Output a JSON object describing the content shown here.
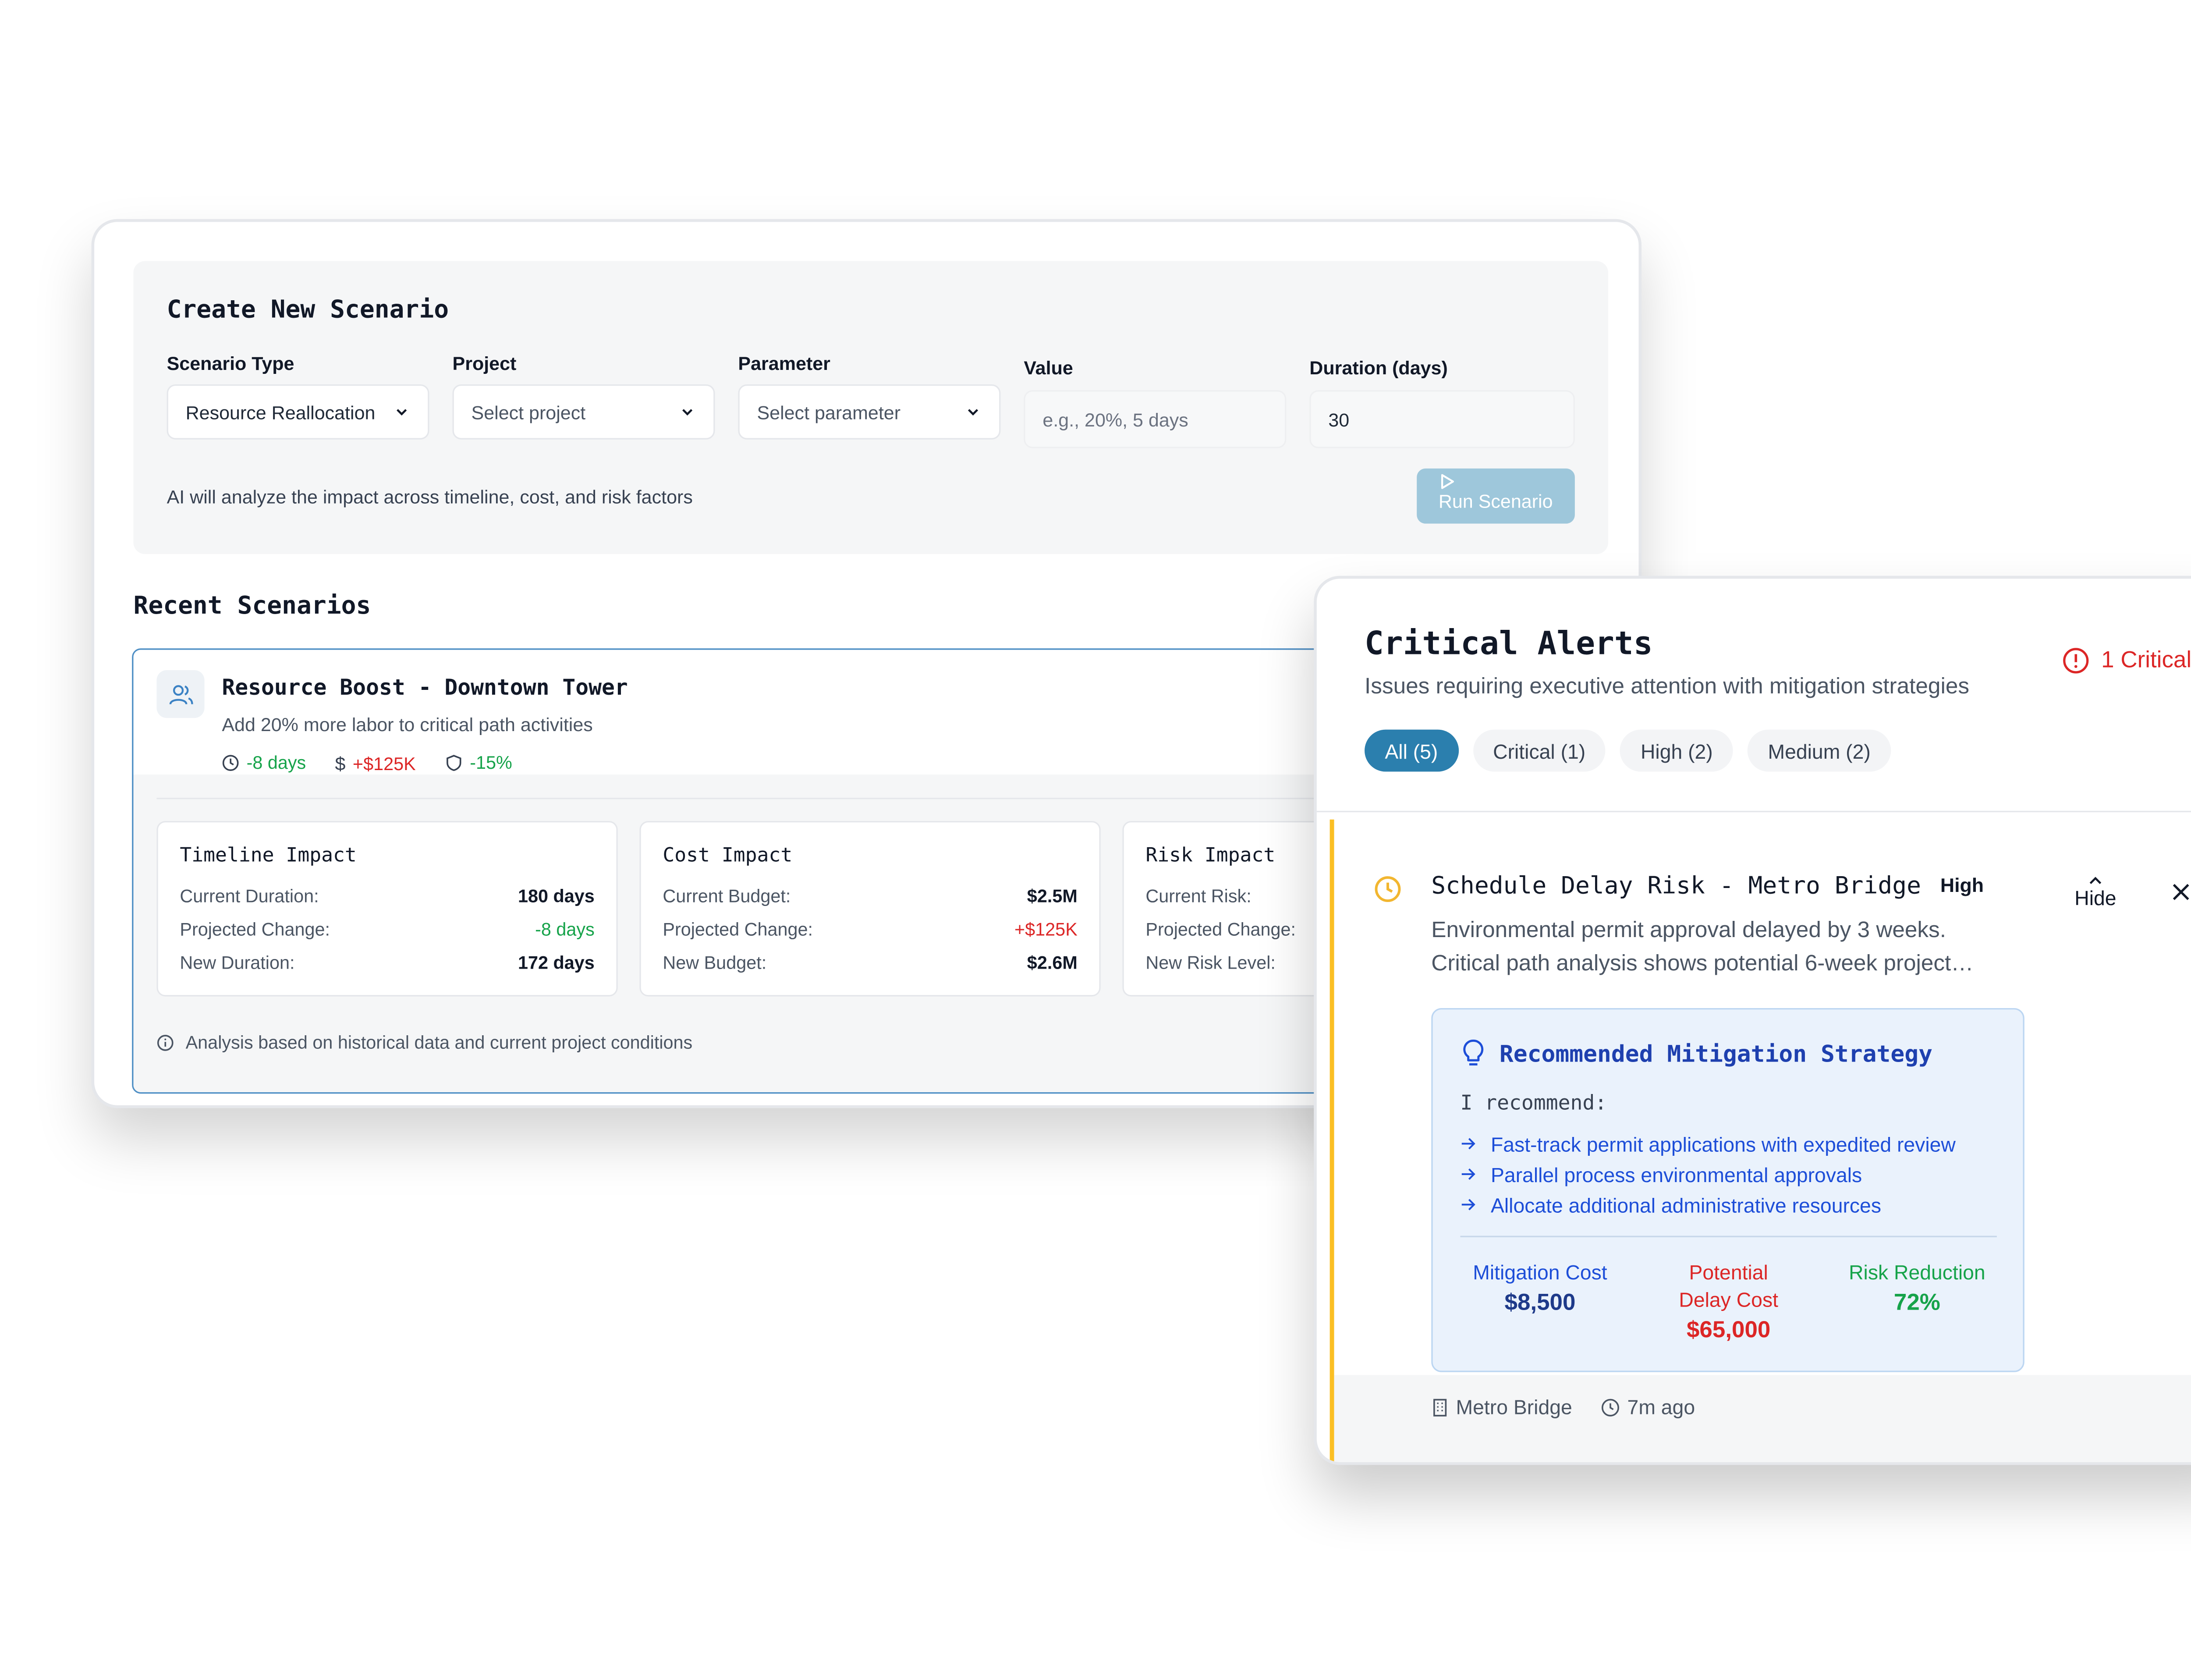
{
  "scenario_form": {
    "title": "Create New Scenario",
    "fields": {
      "type_label": "Scenario Type",
      "type_value": "Resource Reallocation",
      "project_label": "Project",
      "project_placeholder": "Select project",
      "parameter_label": "Parameter",
      "parameter_placeholder": "Select parameter",
      "value_label": "Value",
      "value_placeholder": "e.g., 20%, 5 days",
      "duration_label": "Duration (days)",
      "duration_value": "30"
    },
    "note": "AI will analyze the impact across timeline, cost, and risk factors",
    "run_button": "Run Scenario"
  },
  "recent": {
    "title": "Recent Scenarios",
    "scenario": {
      "name": "Resource Boost - Downtown Tower",
      "description": "Add 20% more labor to critical path activities",
      "metrics": {
        "time": "-8 days",
        "cost": "+$125K",
        "risk": "-15%"
      },
      "impacts": [
        {
          "title": "Timeline Impact",
          "rows": [
            {
              "label": "Current Duration:",
              "value": "180 days"
            },
            {
              "label": "Projected Change:",
              "value": "-8 days"
            },
            {
              "label": "New Duration:",
              "value": "172 days"
            }
          ]
        },
        {
          "title": "Cost Impact",
          "rows": [
            {
              "label": "Current Budget:",
              "value": "$2.5M"
            },
            {
              "label": "Projected Change:",
              "value": "+$125K"
            },
            {
              "label": "New Budget:",
              "value": "$2.6M"
            }
          ]
        },
        {
          "title": "Risk Impact",
          "rows": [
            {
              "label": "Current Risk:",
              "value": ""
            },
            {
              "label": "Projected Change:",
              "value": ""
            },
            {
              "label": "New Risk Level:",
              "value": ""
            }
          ]
        }
      ],
      "footnote": "Analysis based on historical data and current project conditions"
    }
  },
  "alerts": {
    "title": "Critical Alerts",
    "subtitle": "Issues requiring executive attention with mitigation strategies",
    "critical_badge": "1 Critical",
    "filters": [
      "All (5)",
      "Critical (1)",
      "High (2)",
      "Medium (2)"
    ],
    "active_filter": "All (5)",
    "item": {
      "title": "Schedule Delay Risk - Metro Bridge",
      "severity": "High",
      "description": "Environmental permit approval delayed by 3 weeks. Critical path analysis shows potential 6-week project…",
      "hide_label": "Hide",
      "mitigation": {
        "title": "Recommended Mitigation Strategy",
        "lead": "I recommend:",
        "steps": [
          "Fast-track permit applications with expedited review",
          "Parallel process environmental approvals",
          "Allocate additional administrative resources"
        ],
        "stats": [
          {
            "label": "Mitigation Cost",
            "value": "$8,500"
          },
          {
            "label": "Potential Delay Cost",
            "value": "$65,000"
          },
          {
            "label": "Risk Reduction",
            "value": "72%"
          }
        ]
      },
      "location": "Metro Bridge",
      "time_ago": "7m ago"
    }
  },
  "colors": {
    "accent": "#2b7fae",
    "positive": "#16a34a",
    "negative": "#dc2626",
    "mitigation_blue": "#1d4ed8",
    "warning": "#fbbf24"
  },
  "icons": [
    "chevron-down-icon",
    "play-icon",
    "users-icon",
    "clock-icon",
    "dollar-icon",
    "shield-icon",
    "info-icon",
    "alert-circle-icon",
    "chevron-up-icon",
    "close-icon",
    "lightbulb-icon",
    "arrow-right-icon",
    "building-icon"
  ]
}
